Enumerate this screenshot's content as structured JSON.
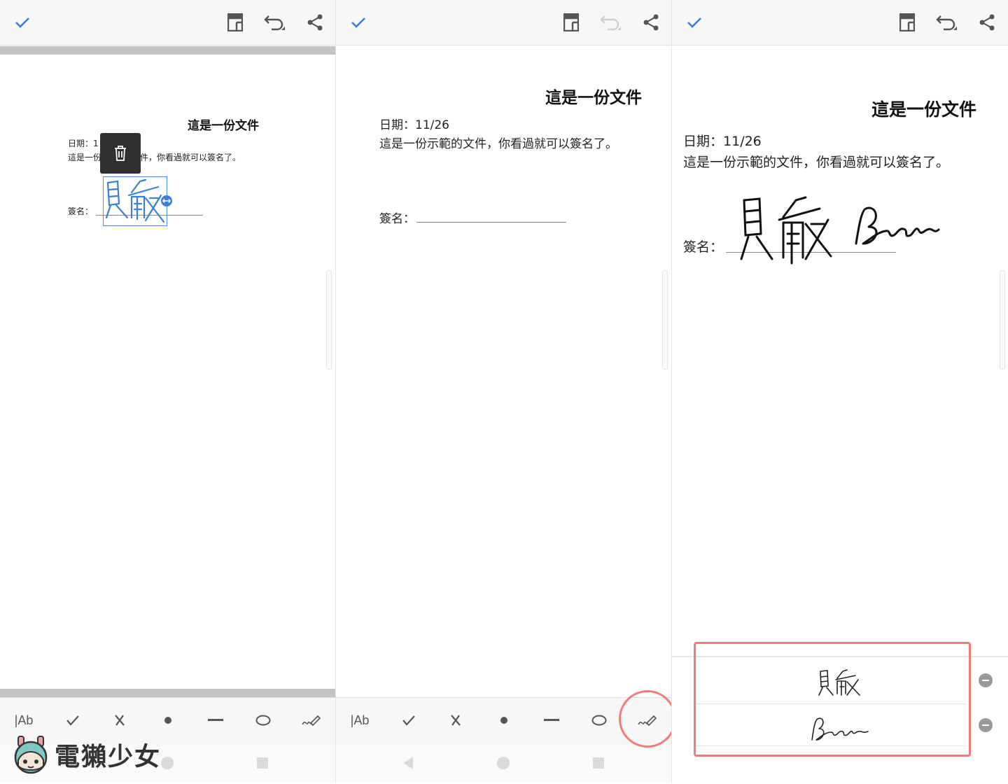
{
  "document": {
    "title": "這是一份文件",
    "date_label": "日期：",
    "date_value": "11/26",
    "body": "這是一份示範的文件，你看過就可以簽名了。",
    "sign_label": "簽名：",
    "partial_date": "日期：1",
    "partial_body_start": "這是一份",
    "partial_body_end": "件，你看過就可以簽名了。"
  },
  "toolbar": {
    "confirm_icon": "check-icon",
    "pages_icon": "document-pages-icon",
    "undo_icon": "undo-icon",
    "share_icon": "share-icon"
  },
  "tools": {
    "text_label": "|Ab",
    "items": [
      "text-tool",
      "check-tool",
      "cross-tool",
      "dot-tool",
      "line-tool",
      "ellipse-tool",
      "signature-tool"
    ]
  },
  "saved_signatures": {
    "items": [
      "signature-1",
      "signature-2"
    ]
  },
  "watermark": {
    "text": "電獺少女"
  },
  "colors": {
    "accent": "#3b7fd6",
    "highlight": "#ef7b7b",
    "toolbar_bg": "#f7f7f7"
  }
}
